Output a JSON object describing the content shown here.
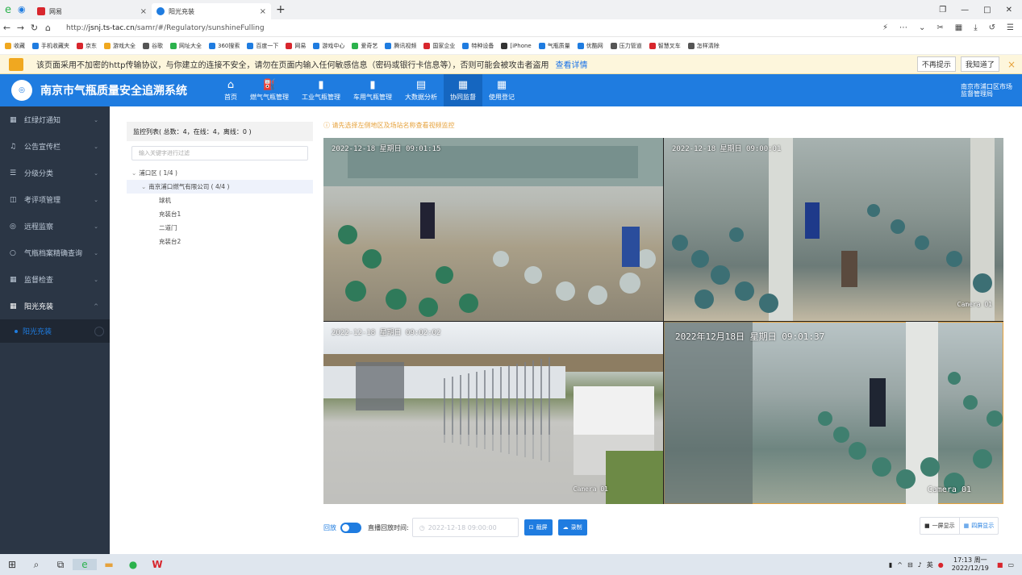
{
  "browser": {
    "tabs": [
      {
        "label": "网易",
        "active": false
      },
      {
        "label": "阳光充装",
        "active": true
      }
    ],
    "url_prefix": "http://",
    "url_host": "jsnj.ts-tac.cn",
    "url_path": "/samr/#/Regulatory/sunshineFulling",
    "bookmarks": [
      "收藏",
      "手机收藏夹",
      "京东",
      "游戏大全",
      "谷歌",
      "网址大全",
      "360搜索",
      "百度一下",
      "网易",
      "游戏中心",
      "爱奇艺",
      "腾讯视频",
      "国家企业",
      "特种设备",
      "[iPhone",
      "气瓶质量",
      "优酷网",
      "压力管道",
      "智慧叉车",
      "怎样清除"
    ],
    "warning": {
      "text": "该页面采用不加密的http传输协议，与你建立的连接不安全，请勿在页面内输入任何敏感信息（密码或银行卡信息等），否则可能会被攻击者盗用",
      "link": "查看详情",
      "btn_dismiss": "不再提示",
      "btn_ok": "我知道了"
    }
  },
  "app": {
    "title": "南京市气瓶质量安全追溯系统",
    "nav": [
      {
        "label": "首页",
        "icon": "home-icon",
        "glyph": "⌂"
      },
      {
        "label": "燃气气瓶管理",
        "icon": "gas-cylinder-icon",
        "glyph": "⛽"
      },
      {
        "label": "工业气瓶管理",
        "icon": "industrial-cylinder-icon",
        "glyph": "▮"
      },
      {
        "label": "车用气瓶管理",
        "icon": "vehicle-cylinder-icon",
        "glyph": "▮"
      },
      {
        "label": "大数据分析",
        "icon": "chart-icon",
        "glyph": "▤"
      },
      {
        "label": "协同监督",
        "icon": "document-icon",
        "glyph": "▦",
        "active": true
      },
      {
        "label": "使用登记",
        "icon": "register-icon",
        "glyph": "▦"
      }
    ],
    "user": "南京市浦口区市场监督管理局"
  },
  "sidebar": {
    "items": [
      {
        "label": "红绿灯通知",
        "icon": "grid-icon",
        "glyph": "▦"
      },
      {
        "label": "公告宣传栏",
        "icon": "bell-icon",
        "glyph": "♫"
      },
      {
        "label": "分级分类",
        "icon": "list-icon",
        "glyph": "☰"
      },
      {
        "label": "考评项管理",
        "icon": "book-icon",
        "glyph": "◫"
      },
      {
        "label": "远程监察",
        "icon": "camera-icon",
        "glyph": "◎"
      },
      {
        "label": "气瓶档案精确查询",
        "icon": "search-icon",
        "glyph": "○"
      },
      {
        "label": "监督检查",
        "icon": "grid-icon",
        "glyph": "▦"
      },
      {
        "label": "阳光充装",
        "icon": "grid-icon",
        "glyph": "▦",
        "open": true
      }
    ],
    "sub_item": "阳光充装"
  },
  "monitor": {
    "header": "监控列表( 总数：4，在线：4，离线：0 )",
    "search_placeholder": "输入关键字进行过滤",
    "tree": {
      "district": "浦口区 ( 1/4 )",
      "company": "南京浦口燃气有限公司 ( 4/4 )",
      "cameras": [
        "球机",
        "充装台1",
        "二道门",
        "充装台2"
      ]
    },
    "tip": "请先选择左侧地区及场站名称查看视频监控",
    "videos": [
      {
        "timestamp": "2022-12-18 星期日 09:01:15",
        "label": ""
      },
      {
        "timestamp": "2022-12-18 星期日 09:00:01",
        "label": "Camera 01"
      },
      {
        "timestamp": "2022-12-18 星期日 09:02:02",
        "label": "Camera 01"
      },
      {
        "timestamp": "2022年12月18日  星期日  09:01:37",
        "label": "Camera 01"
      }
    ],
    "playback_label": "回放",
    "time_label": "直播回放时间:",
    "time_value": "2022-12-18 09:00:00",
    "btn_screenshot": "截屏",
    "btn_record": "录制",
    "btn_single": "一屏显示",
    "btn_quad": "四屏显示"
  },
  "taskbar": {
    "time": "17:13 周一",
    "date": "2022/12/19"
  }
}
